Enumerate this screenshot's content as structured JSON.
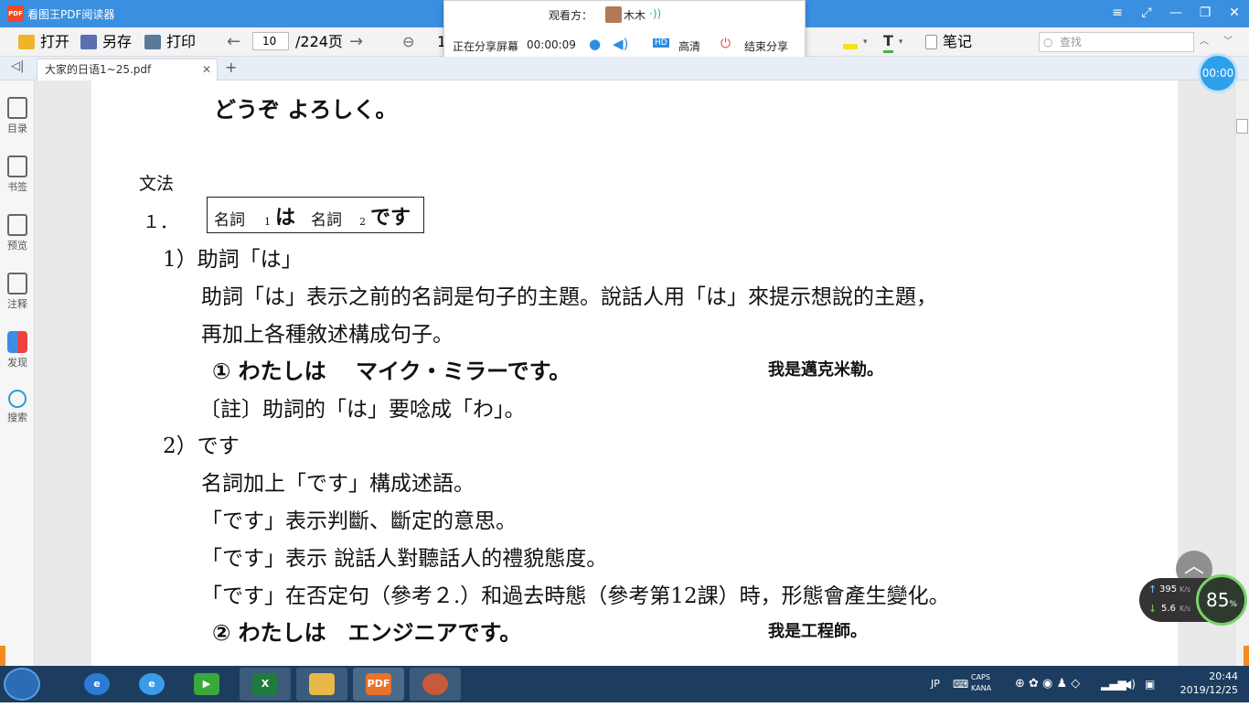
{
  "window": {
    "title": "看图王PDF阅读器",
    "logo_text": "PDF",
    "controls": [
      "≡",
      "⤢",
      "—",
      "❐",
      "✕"
    ]
  },
  "toolbar": {
    "open": "打开",
    "save_as": "另存",
    "print": "打印",
    "page_current": "10",
    "page_total": "/224页",
    "zoom_partial": "1",
    "notes": "笔记",
    "search_placeholder": "查找"
  },
  "share_panel": {
    "viewer_label": "观看方：",
    "viewer_name": "木木",
    "status": "正在分享屏幕",
    "elapsed": "00:00:09",
    "hd_badge": "HD",
    "quality": "高清",
    "end_share": "结束分享"
  },
  "tabs": [
    {
      "label": "大家的日语1~25.pdf"
    }
  ],
  "sidebar": [
    {
      "label": "目录"
    },
    {
      "label": "书签"
    },
    {
      "label": "预览"
    },
    {
      "label": "注释"
    },
    {
      "label": "发现"
    },
    {
      "label": "搜索"
    }
  ],
  "timer": {
    "value": "00:00"
  },
  "document": {
    "line_top": "どうぞ よろしく。",
    "section": "文法",
    "item1_no": "１．",
    "pattern": {
      "n1": "名詞",
      "sub1": "1",
      "wa": "は",
      "n2": "名詞",
      "sub2": "2",
      "desu": "です"
    },
    "p1_head": "1）助詞「は」",
    "p1_line1": "助詞「は」表示之前的名詞是句子的主題。說話人用「は」來提示想說的主題，",
    "p1_line2": "再加上各種敘述構成句子。",
    "ex1_jp": "①  わたしは　 マイク・ミラーです。",
    "ex1_cn": "我是邁克米勒。",
    "note1": "〔註〕助詞的「は」要唸成「わ」。",
    "p2_head": "2）です",
    "p2_line1": "名詞加上「です」構成述語。",
    "p2_line2": "「です」表示判斷、斷定的意思。",
    "p2_line3": "「です」表示 說話人對聽話人的禮貌態度。",
    "p2_line4": "「です」在否定句（參考２.）和過去時態（參考第12課）時，形態會產生變化。",
    "ex2_jp": "②  わたしは　エンジニアです。",
    "ex2_cn": "我是工程師。"
  },
  "overlay": {
    "up_arrow": "^",
    "net_up": "395",
    "net_down": "5.6",
    "net_unit": "K/s",
    "gauge": "85",
    "gauge_unit": "%"
  },
  "taskbar": {
    "apps": [
      {
        "name": "ie"
      },
      {
        "name": "ie-alt"
      },
      {
        "name": "media-player"
      },
      {
        "name": "excel",
        "text": "X"
      },
      {
        "name": "folder"
      },
      {
        "name": "pdf",
        "text": "PDF"
      },
      {
        "name": "avatar-app"
      }
    ],
    "tray_lang": "JP",
    "caps": "CAPS",
    "kana": "KANA",
    "time": "20:44",
    "date": "2019/12/25"
  }
}
